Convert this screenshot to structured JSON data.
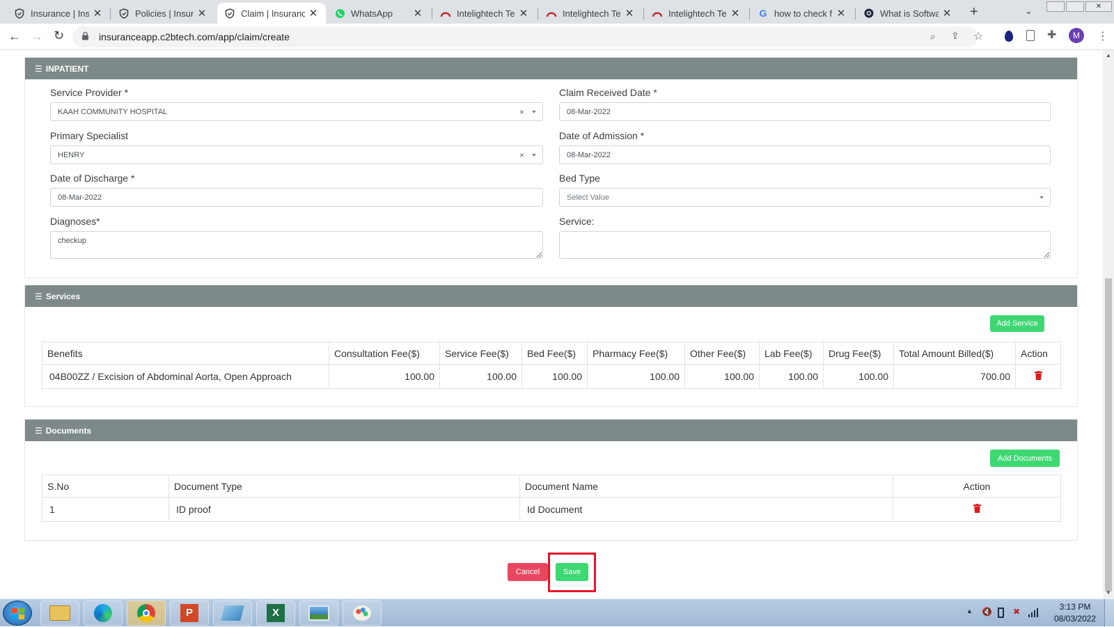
{
  "browser": {
    "tabs": [
      {
        "label": "Insurance | Insura",
        "icon": "shield-icon"
      },
      {
        "label": "Policies | Insuran",
        "icon": "shield-icon"
      },
      {
        "label": "Claim | Insurance",
        "icon": "shield-icon",
        "active": true
      },
      {
        "label": "WhatsApp",
        "icon": "whatsapp-icon"
      },
      {
        "label": "Intelightech Tean",
        "icon": "intelightech-icon"
      },
      {
        "label": "Intelightech Tean",
        "icon": "intelightech-icon"
      },
      {
        "label": "Intelightech Tean",
        "icon": "intelightech-icon"
      },
      {
        "label": "how to check fun",
        "icon": "google-icon"
      },
      {
        "label": "What is Software",
        "icon": "site-icon"
      }
    ],
    "url": "insuranceapp.c2btech.com/app/claim/create",
    "profile_initial": "M"
  },
  "inpatient": {
    "header": "INPATIENT",
    "service_provider_label": "Service Provider *",
    "service_provider_value": "KAAH COMMUNITY HOSPITAL",
    "claim_received_label": "Claim Received Date *",
    "claim_received_value": "08-Mar-2022",
    "primary_specialist_label": "Primary Specialist",
    "primary_specialist_value": "HENRY",
    "admission_label": "Date of Admission *",
    "admission_value": "08-Mar-2022",
    "discharge_label": "Date of Discharge *",
    "discharge_value": "08-Mar-2022",
    "bed_type_label": "Bed Type",
    "bed_type_placeholder": "Select Value",
    "diagnoses_label": "Diagnoses*",
    "diagnoses_value": "checkup",
    "service_label": "Service:",
    "service_value": ""
  },
  "services": {
    "header": "Services",
    "add_button": "Add Service",
    "columns": [
      "Benefits",
      "Consultation Fee($)",
      "Service Fee($)",
      "Bed Fee($)",
      "Pharmacy Fee($)",
      "Other Fee($)",
      "Lab Fee($)",
      "Drug Fee($)",
      "Total Amount Billed($)",
      "Action"
    ],
    "rows": [
      {
        "benefit": "04B00ZZ / Excision of Abdominal Aorta, Open Approach",
        "consultation": "100.00",
        "service": "100.00",
        "bed": "100.00",
        "pharmacy": "100.00",
        "other": "100.00",
        "lab": "100.00",
        "drug": "100.00",
        "total": "700.00"
      }
    ]
  },
  "documents": {
    "header": "Documents",
    "add_button": "Add Documents",
    "columns": [
      "S.No",
      "Document Type",
      "Document Name",
      "Action"
    ],
    "rows": [
      {
        "sno": "1",
        "type": "ID proof",
        "name": "Id Document"
      }
    ]
  },
  "actions": {
    "cancel": "Cancel",
    "save": "Save"
  },
  "colors": {
    "card_header": "#7d8a89",
    "green": "#3ed873",
    "red": "#e8485f",
    "highlight": "#e8132a"
  },
  "clock": {
    "time": "3:13 PM",
    "date": "08/03/2022"
  }
}
